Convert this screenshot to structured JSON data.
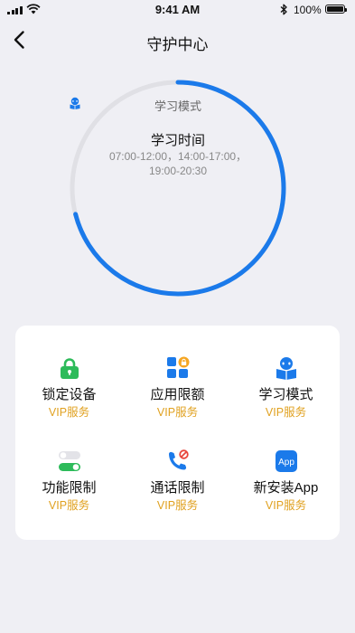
{
  "status_bar": {
    "time": "9:41 AM",
    "battery": "100%"
  },
  "nav": {
    "title": "守护中心"
  },
  "ring": {
    "mode_label": "学习模式",
    "title": "学习时间",
    "times": "07:00-12:00，14:00-17:00，19:00-20:30",
    "progress": 0.71,
    "track_color": "#e0e0e5",
    "progress_color": "#1b7aea"
  },
  "features": [
    {
      "label": "锁定设备",
      "sub": "VIP服务",
      "icon": "lock-icon"
    },
    {
      "label": "应用限额",
      "sub": "VIP服务",
      "icon": "app-limit-icon"
    },
    {
      "label": "学习模式",
      "sub": "VIP服务",
      "icon": "study-mode-icon"
    },
    {
      "label": "功能限制",
      "sub": "VIP服务",
      "icon": "toggle-icon"
    },
    {
      "label": "通话限制",
      "sub": "VIP服务",
      "icon": "phone-block-icon"
    },
    {
      "label": "新安装App",
      "sub": "VIP服务",
      "icon": "app-install-icon",
      "icon_text": "App"
    }
  ]
}
